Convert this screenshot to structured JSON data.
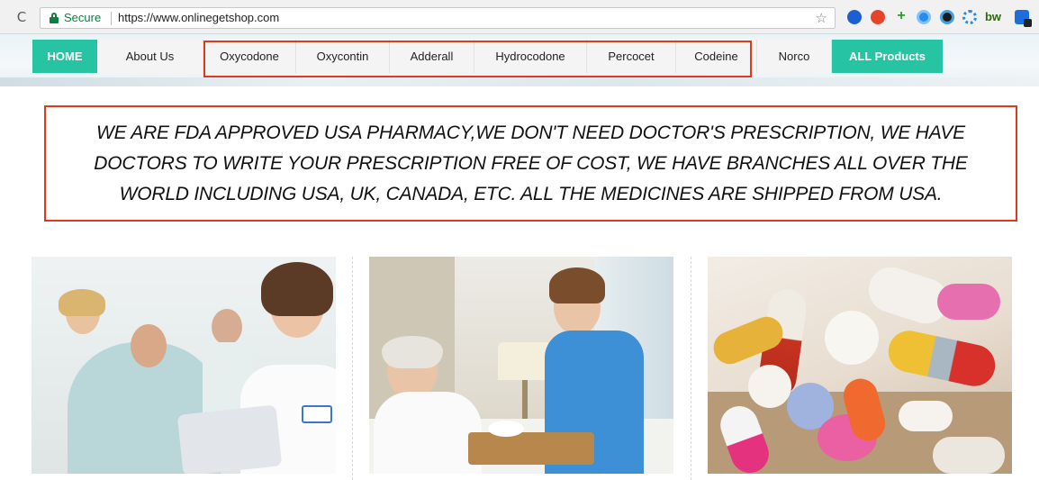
{
  "browser": {
    "secure_label": "Secure",
    "url": "https://www.onlinegetshop.com",
    "reload_glyph": "C",
    "star_glyph": "☆",
    "extensions": [
      "blue-extension-icon",
      "red-extension-icon",
      "green-plus-extension-icon",
      "blue-ring-extension-icon",
      "dark-globe-extension-icon",
      "gear-extension-icon",
      "bw-extension-icon",
      "user-extension-icon"
    ],
    "bw_label": "bw"
  },
  "nav": {
    "items": [
      {
        "label": "HOME",
        "active": true
      },
      {
        "label": "About Us"
      },
      {
        "label": "Oxycodone"
      },
      {
        "label": "Oxycontin"
      },
      {
        "label": "Adderall"
      },
      {
        "label": "Hydrocodone"
      },
      {
        "label": "Percocet"
      },
      {
        "label": "Codeine"
      },
      {
        "label": "Norco"
      },
      {
        "label": "ALL Products",
        "accent": true
      }
    ],
    "accent_color": "#27c4a4"
  },
  "notice": {
    "text": "WE ARE FDA APPROVED USA PHARMACY,WE DON'T NEED DOCTOR'S PRESCRIPTION, WE HAVE DOCTORS TO WRITE YOUR PRESCRIPTION FREE OF COST, WE HAVE BRANCHES ALL OVER THE WORLD INCLUDING USA, UK, CANADA, ETC. ALL THE MEDICINES ARE SHIPPED FROM USA.",
    "border_color": "#e03a1c"
  },
  "cards": [
    {
      "image": "doctor-with-patients-photo"
    },
    {
      "image": "nurse-serving-elderly-patient-photo"
    },
    {
      "image": "assorted-pills-photo"
    }
  ]
}
